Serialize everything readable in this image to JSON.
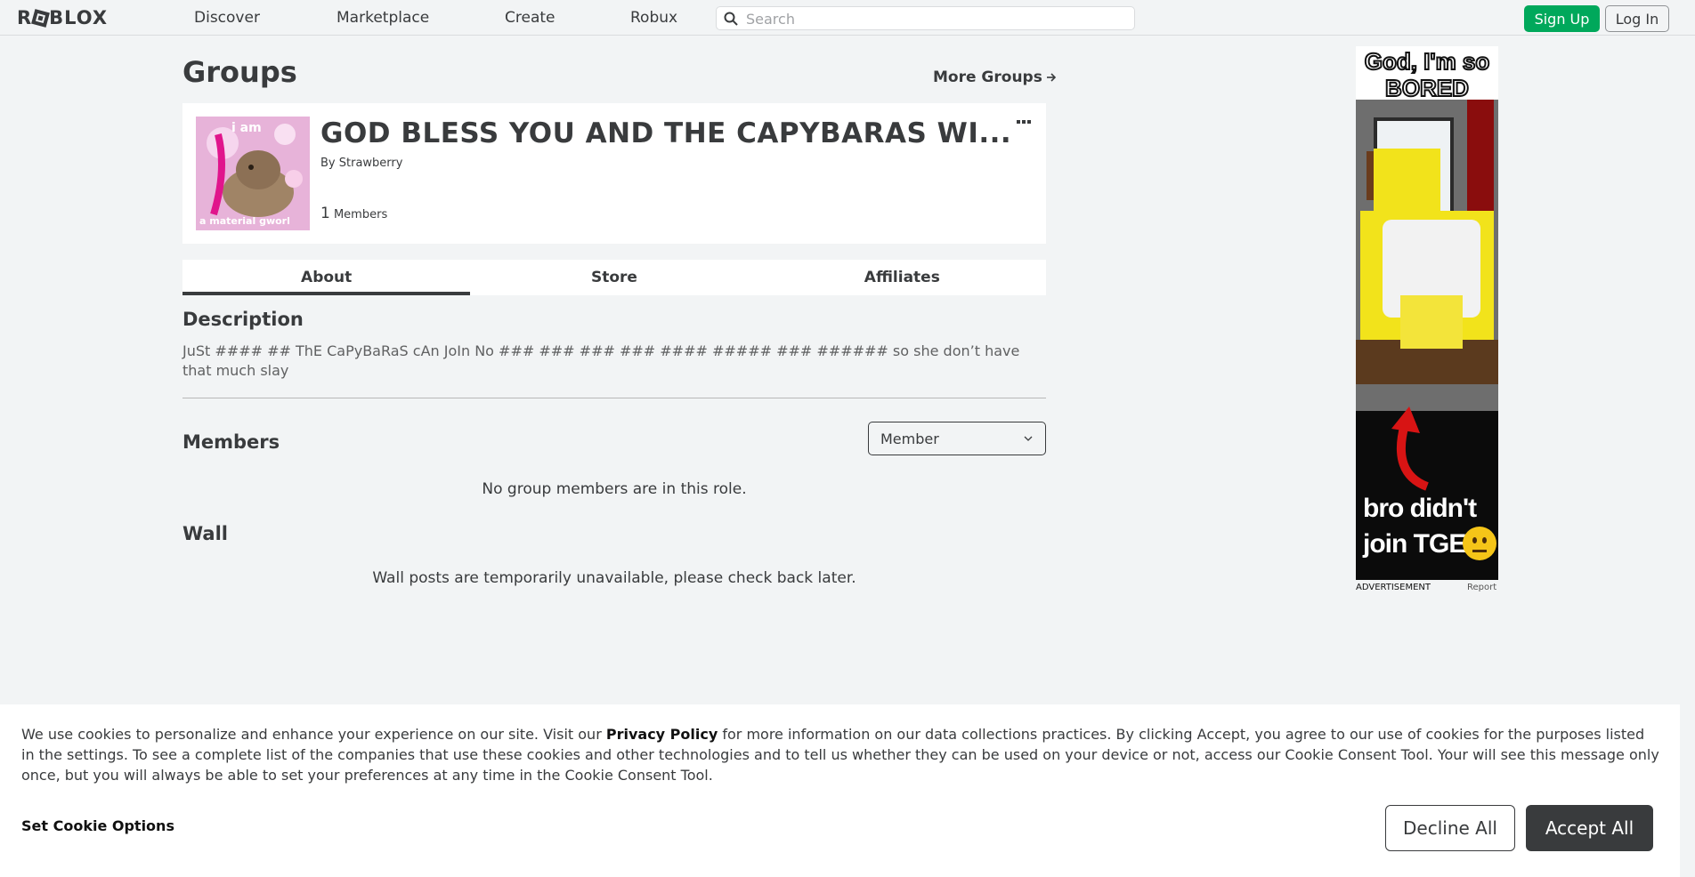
{
  "nav": {
    "logo": "ROBLOX",
    "items": [
      "Discover",
      "Marketplace",
      "Create",
      "Robux"
    ],
    "search_placeholder": "Search",
    "signup_label": "Sign Up",
    "login_label": "Log In"
  },
  "page": {
    "title": "Groups",
    "more_groups_label": "More Groups"
  },
  "group": {
    "name": "GOD BLESS YOU AND THE CAPYBARAS WI...",
    "by_prefix": "By",
    "owner": "Strawberry",
    "member_count": "1",
    "members_label": "Members",
    "thumb_text_top": "i am",
    "thumb_text_bottom": "a material gworl"
  },
  "tabs": [
    "About",
    "Store",
    "Affiliates"
  ],
  "about": {
    "description_title": "Description",
    "description": "JuSt #### ## ThE CaPyBaRaS cAn JoIn No ### ### ### ### #### ##### ### ###### so she don’t have that much slay",
    "members_title": "Members",
    "role_selected": "Member",
    "no_members_msg": "No group members are in this role.",
    "wall_title": "Wall",
    "wall_msg": "Wall posts are temporarily unavailable, please check back later."
  },
  "ad": {
    "top_text": "God, I'm so BORED",
    "bottom_text_line1": "bro didn't",
    "bottom_text_line2": "join TGE",
    "label": "ADVERTISEMENT",
    "report": "Report"
  },
  "cookie": {
    "text_before": "We use cookies to personalize and enhance your experience on our site. Visit our ",
    "policy_link": "Privacy Policy",
    "text_after": " for more information on our data collections practices. By clicking Accept, you agree to our use of cookies for the purposes listed in the settings. To see a complete list of the companies that use these cookies and other technologies and to tell us whether they can be used on your device or not, access our Cookie Consent Tool. Your will see this message only once, but you will always be able to set your preferences at any time in the Cookie Consent Tool.",
    "options_label": "Set Cookie Options",
    "decline_label": "Decline All",
    "accept_label": "Accept All"
  }
}
